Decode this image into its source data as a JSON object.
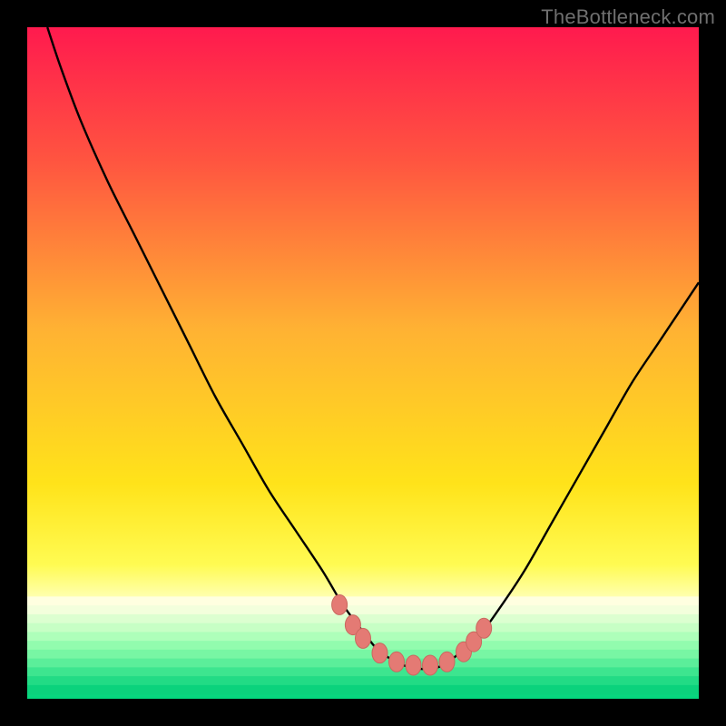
{
  "watermark": "TheBottleneck.com",
  "colors": {
    "frame": "#000000",
    "curve": "#000000",
    "marker_fill": "#e47a74",
    "marker_stroke": "#c9685f",
    "gradient_stops": [
      {
        "offset": 0.0,
        "color": "#ff1a4e"
      },
      {
        "offset": 0.2,
        "color": "#ff5540"
      },
      {
        "offset": 0.45,
        "color": "#ffb233"
      },
      {
        "offset": 0.68,
        "color": "#ffe31a"
      },
      {
        "offset": 0.8,
        "color": "#fffb52"
      },
      {
        "offset": 0.845,
        "color": "#ffffa8"
      },
      {
        "offset": 0.865,
        "color": "#ffffe0"
      },
      {
        "offset": 0.885,
        "color": "#e2ffd4"
      },
      {
        "offset": 0.905,
        "color": "#b7ffc1"
      },
      {
        "offset": 0.935,
        "color": "#68f99d"
      },
      {
        "offset": 0.965,
        "color": "#22e38a"
      },
      {
        "offset": 1.0,
        "color": "#04d57d"
      }
    ]
  },
  "chart_data": {
    "type": "line",
    "title": "",
    "xlabel": "",
    "ylabel": "",
    "xlim": [
      0,
      100
    ],
    "ylim": [
      0,
      100
    ],
    "series": [
      {
        "name": "bottleneck-curve",
        "x": [
          3,
          5,
          8,
          12,
          16,
          20,
          24,
          28,
          32,
          36,
          40,
          44,
          47,
          50,
          52,
          54,
          56,
          58,
          60,
          62,
          64,
          67,
          70,
          74,
          78,
          82,
          86,
          90,
          94,
          98,
          100
        ],
        "y": [
          100,
          94,
          86,
          77,
          69,
          61,
          53,
          45,
          38,
          31,
          25,
          19,
          14,
          10,
          7.5,
          6,
          5,
          4.5,
          4.5,
          5,
          6.5,
          9,
          13,
          19,
          26,
          33,
          40,
          47,
          53,
          59,
          62
        ]
      }
    ],
    "markers": {
      "name": "highlight-points",
      "x": [
        46.5,
        48.5,
        50,
        52.5,
        55,
        57.5,
        60,
        62.5,
        65,
        66.5,
        68
      ],
      "y": [
        14,
        11,
        9,
        6.8,
        5.5,
        5,
        5,
        5.5,
        7,
        8.5,
        10.5
      ]
    }
  }
}
